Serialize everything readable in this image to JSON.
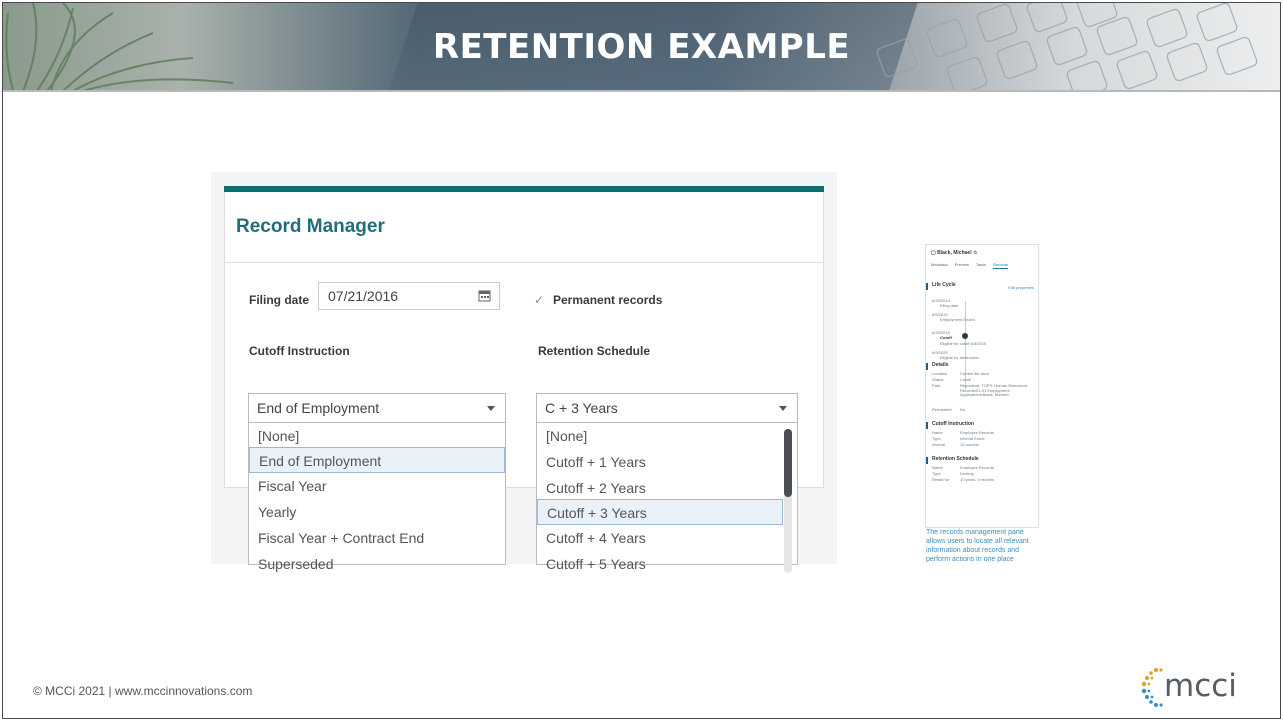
{
  "slide": {
    "title": "RETENTION EXAMPLE",
    "footer": "© MCCi 2021 | www.mccinnovations.com",
    "logo_text": "mcci"
  },
  "record_manager": {
    "title": "Record Manager",
    "filing_date_label": "Filing date",
    "filing_date_value": "07/21/2016",
    "permanent_records_label": "Permanent records",
    "permanent_records_checked": true,
    "cutoff": {
      "label": "Cutoff Instruction",
      "selected": "End of Employment",
      "options": [
        "[None]",
        "End of Employment",
        "Fiscal Year",
        "Yearly",
        "Fiscal Year + Contract End",
        "Superseded"
      ],
      "highlighted_index": 1
    },
    "retention": {
      "label": "Retention Schedule",
      "selected": "C + 3 Years",
      "options": [
        "[None]",
        "Cutoff + 1 Years",
        "Cutoff + 2 Years",
        "Cutoff + 3 Years",
        "Cutoff + 4 Years",
        "Cutoff + 5 Years"
      ],
      "highlighted_index": 3
    }
  },
  "preview_pane": {
    "header": "Black, Michael",
    "tabs": [
      "Metadata",
      "Preview",
      "Tasks",
      "Records"
    ],
    "active_tab": "Records",
    "life_cycle": {
      "title": "Life Cycle",
      "edit_link": "Edit properties",
      "events": [
        {
          "date": "6/19/2014",
          "text": "Filing date"
        },
        {
          "date": "6/9/2015",
          "text": "Employment Ended"
        },
        {
          "date": "6/19/2015",
          "text": "Cutoff"
        },
        {
          "date": "6/9/2025",
          "text": "Eligible for destruction"
        }
      ],
      "note": "Eligible for cutoff 6/8/2015"
    },
    "details": {
      "title": "Details",
      "rows": [
        {
          "k": "Location",
          "v": "Current file area"
        },
        {
          "k": "Status",
          "v": "Cutoff"
        },
        {
          "k": "Path",
          "v": "Repository: TOPS: Human Resources Records/01-01 Employment Applications/Black, Michael"
        },
        {
          "k": "Permanent",
          "v": "No"
        }
      ]
    },
    "cutoff_instruction": {
      "title": "Cutoff Instruction",
      "rows": [
        {
          "k": "Name",
          "v": "Employee Records"
        },
        {
          "k": "Type",
          "v": "Interval Event"
        },
        {
          "k": "Interval",
          "v": "12 months"
        }
      ]
    },
    "retention_schedule": {
      "title": "Retention Schedule",
      "rows": [
        {
          "k": "Name",
          "v": "Employee Records"
        },
        {
          "k": "Type",
          "v": "Destroy"
        },
        {
          "k": "Retain for",
          "v": "10 years, 0 months"
        }
      ]
    },
    "caption": "The records management pane allows users to locate all relevant information about records and perform actions in one place"
  },
  "colors": {
    "teal_bar": "#0f6d70",
    "title_teal": "#1f6f7a",
    "selection_bg": "#eaf1f8",
    "caption_blue": "#3b8fbd"
  },
  "icons": [
    "calendar-icon",
    "checkbox-icon",
    "chevron-down-icon",
    "star-icon",
    "file-icon"
  ]
}
